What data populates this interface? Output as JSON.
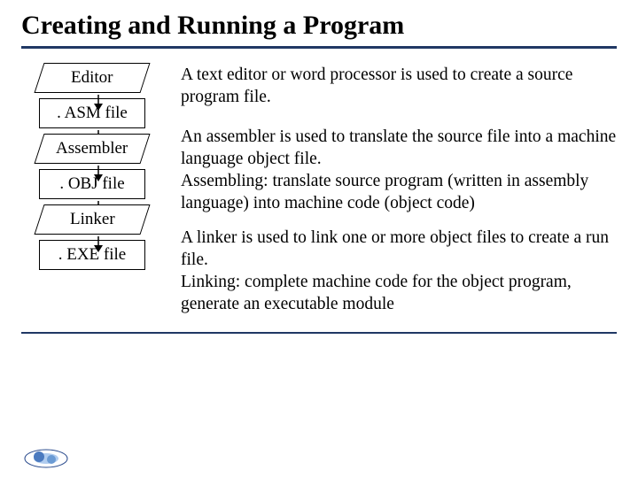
{
  "title": "Creating and Running a Program",
  "flow": {
    "editor": "Editor",
    "asm": ". ASM file",
    "assembler": "Assembler",
    "obj": ". OBJ file",
    "linker": "Linker",
    "exe": ". EXE file"
  },
  "desc": {
    "editor": "A text editor or word processor is used to create a source program file.",
    "assembler": "An assembler  is used to translate the source file into a machine language object file.\nAssembling: translate source program (written in assembly language) into machine code (object code)",
    "linker": "A linker is used to link one or more object files to create a run file.\nLinking: complete machine code for the object program, generate an executable module"
  },
  "colors": {
    "rule": "#203864"
  }
}
